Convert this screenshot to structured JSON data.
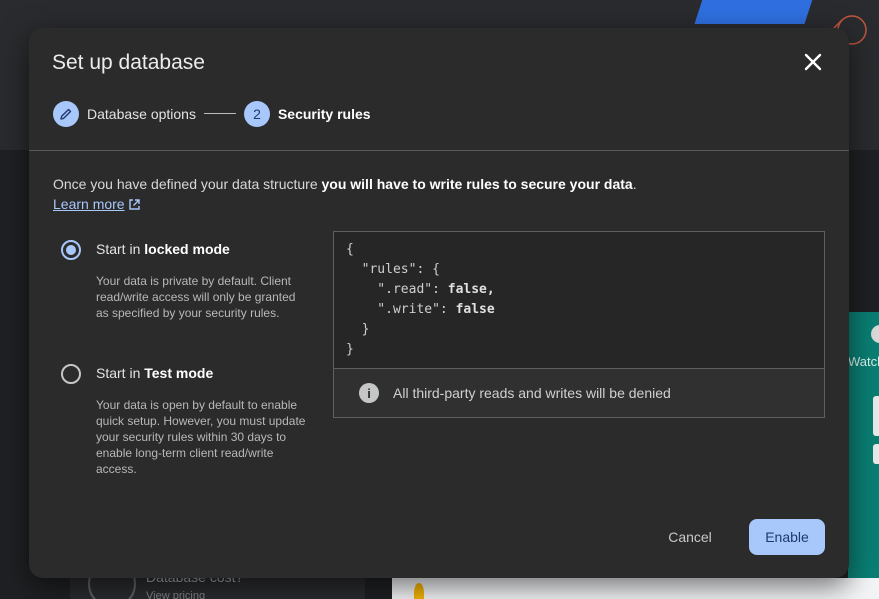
{
  "background": {
    "card_title": "Database cost?",
    "card_subtitle": "View pricing",
    "side_label": "Watch"
  },
  "dialog": {
    "title": "Set up database",
    "steps": [
      {
        "label": "Database options",
        "icon": "pencil-icon",
        "state": "completed"
      },
      {
        "number": "2",
        "label": "Security rules",
        "state": "active"
      }
    ],
    "intro_text": "Once you have defined your data structure ",
    "intro_bold": "you will have to write rules to secure your data",
    "intro_end": ".",
    "learn_more": "Learn more",
    "options": [
      {
        "title_prefix": "Start in ",
        "title_bold": "locked mode",
        "description": "Your data is private by default. Client read/write access will only be granted as specified by your security rules.",
        "selected": true
      },
      {
        "title_prefix": "Start in ",
        "title_bold": "Test mode",
        "description": "Your data is open by default to enable quick setup. However, you must update your security rules within 30 days to enable long-term client read/write access.",
        "selected": false
      }
    ],
    "rules_code": {
      "line1": "{",
      "line2": "  \"rules\": {",
      "line3_key": "    \".read\": ",
      "line3_val": "false,",
      "line4_key": "    \".write\": ",
      "line4_val": "false",
      "line5": "  }",
      "line6": "}"
    },
    "notice": "All third-party reads and writes will be denied",
    "cancel_label": "Cancel",
    "enable_label": "Enable"
  },
  "colors": {
    "accent": "#a8c7fa",
    "dialog_bg": "#2b2b2b"
  }
}
